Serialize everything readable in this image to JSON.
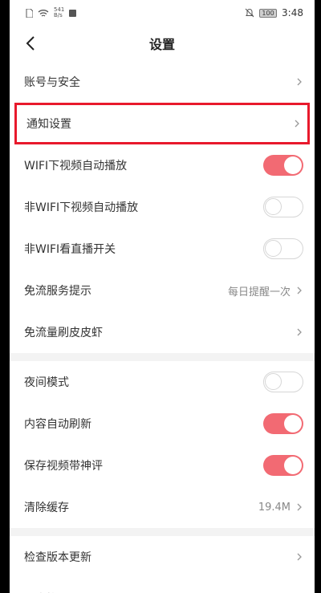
{
  "status": {
    "speed_num": "541",
    "speed_unit": "B/s",
    "battery": "100",
    "time": "3:48"
  },
  "nav": {
    "title": "设置"
  },
  "group1": [
    {
      "label": "账号与安全",
      "type": "link"
    },
    {
      "label": "通知设置",
      "type": "link",
      "highlighted": true
    },
    {
      "label": "WIFI下视频自动播放",
      "type": "toggle",
      "on": true
    },
    {
      "label": "非WIFI下视频自动播放",
      "type": "toggle",
      "on": false
    },
    {
      "label": "非WIFI看直播开关",
      "type": "toggle",
      "on": false
    },
    {
      "label": "免流服务提示",
      "type": "link",
      "value": "每日提醒一次"
    },
    {
      "label": "免流量刷皮皮虾",
      "type": "link"
    }
  ],
  "group2": [
    {
      "label": "夜间模式",
      "type": "toggle",
      "on": false
    },
    {
      "label": "内容自动刷新",
      "type": "toggle",
      "on": true
    },
    {
      "label": "保存视频带神评",
      "type": "toggle",
      "on": true
    },
    {
      "label": "清除缓存",
      "type": "link",
      "value": "19.4M"
    }
  ],
  "group3": [
    {
      "label": "检查版本更新",
      "type": "link"
    },
    {
      "label": "用户协议",
      "type": "link"
    }
  ],
  "colors": {
    "toggle_on": "#f26a73",
    "highlight_border": "#e8192c"
  }
}
